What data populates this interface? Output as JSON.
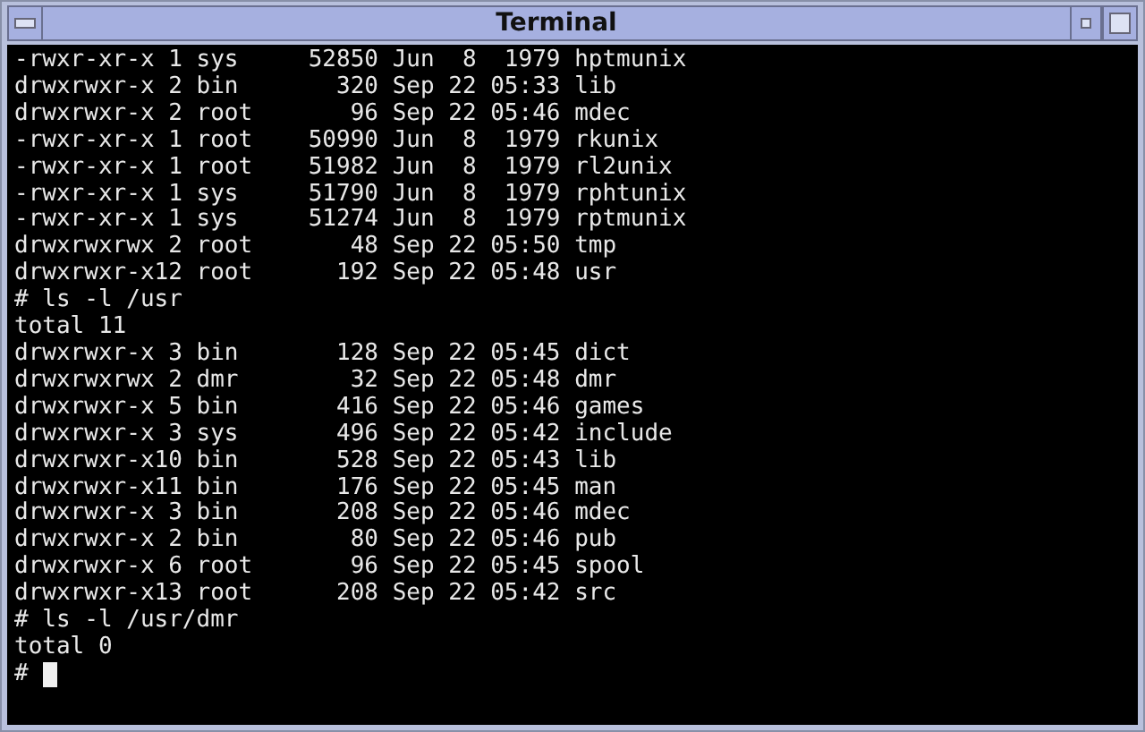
{
  "window": {
    "title": "Terminal"
  },
  "terminal": {
    "lines": [
      "-rwxr-xr-x 1 sys     52850 Jun  8  1979 hptmunix",
      "drwxrwxr-x 2 bin       320 Sep 22 05:33 lib",
      "drwxrwxr-x 2 root       96 Sep 22 05:46 mdec",
      "-rwxr-xr-x 1 root    50990 Jun  8  1979 rkunix",
      "-rwxr-xr-x 1 root    51982 Jun  8  1979 rl2unix",
      "-rwxr-xr-x 1 sys     51790 Jun  8  1979 rphtunix",
      "-rwxr-xr-x 1 sys     51274 Jun  8  1979 rptmunix",
      "drwxrwxrwx 2 root       48 Sep 22 05:50 tmp",
      "drwxrwxr-x12 root      192 Sep 22 05:48 usr",
      "# ls -l /usr",
      "total 11",
      "drwxrwxr-x 3 bin       128 Sep 22 05:45 dict",
      "drwxrwxrwx 2 dmr        32 Sep 22 05:48 dmr",
      "drwxrwxr-x 5 bin       416 Sep 22 05:46 games",
      "drwxrwxr-x 3 sys       496 Sep 22 05:42 include",
      "drwxrwxr-x10 bin       528 Sep 22 05:43 lib",
      "drwxrwxr-x11 bin       176 Sep 22 05:45 man",
      "drwxrwxr-x 3 bin       208 Sep 22 05:46 mdec",
      "drwxrwxr-x 2 bin        80 Sep 22 05:46 pub",
      "drwxrwxr-x 6 root       96 Sep 22 05:45 spool",
      "drwxrwxr-x13 root      208 Sep 22 05:42 src",
      "# ls -l /usr/dmr",
      "total 0"
    ],
    "prompt": "#"
  }
}
